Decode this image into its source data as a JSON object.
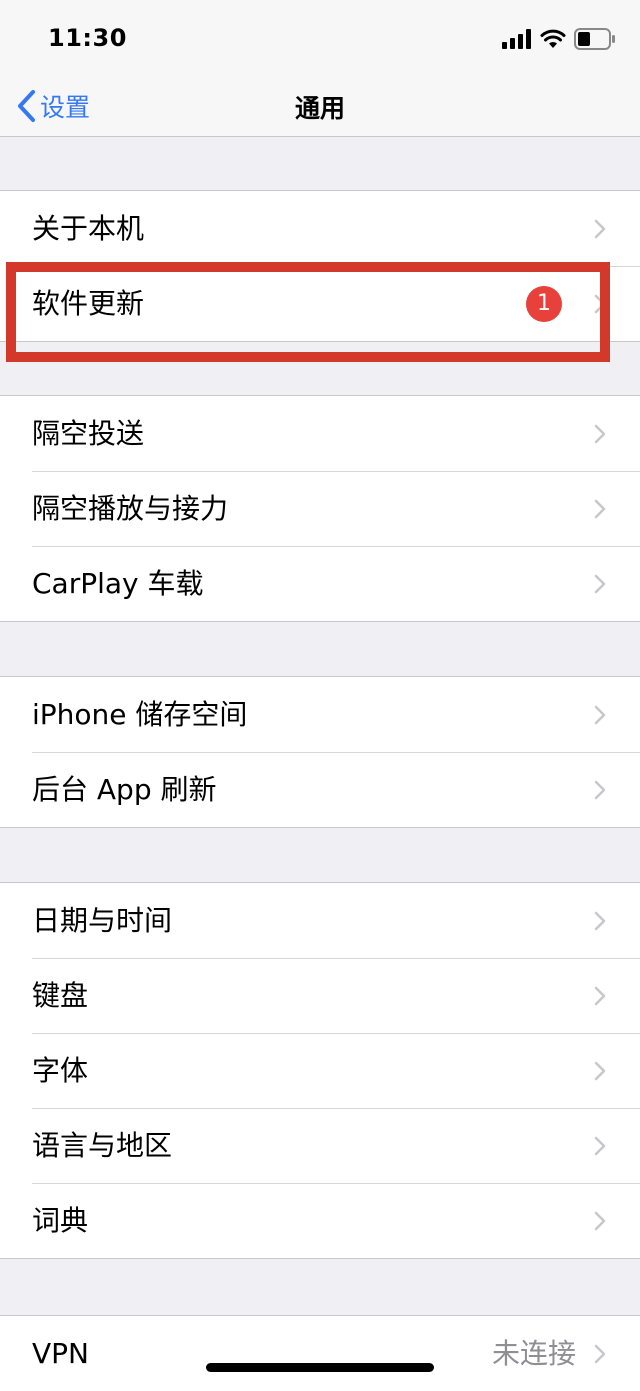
{
  "status_bar": {
    "time": "11:30",
    "icons": [
      "cellular-signal-icon",
      "wifi-icon",
      "battery-icon"
    ]
  },
  "nav": {
    "back_label": "设置",
    "title": "通用",
    "accent_color": "#3478f6"
  },
  "groups": [
    {
      "items": [
        {
          "id": "about",
          "label": "关于本机"
        },
        {
          "id": "software-update",
          "label": "软件更新",
          "badge": "1"
        }
      ]
    },
    {
      "items": [
        {
          "id": "airdrop",
          "label": "隔空投送"
        },
        {
          "id": "airplay-handoff",
          "label": "隔空播放与接力"
        },
        {
          "id": "carplay",
          "label": "CarPlay 车载"
        }
      ]
    },
    {
      "items": [
        {
          "id": "iphone-storage",
          "label": "iPhone 储存空间"
        },
        {
          "id": "background-app-refresh",
          "label": "后台 App 刷新"
        }
      ]
    },
    {
      "items": [
        {
          "id": "date-time",
          "label": "日期与时间"
        },
        {
          "id": "keyboard",
          "label": "键盘"
        },
        {
          "id": "fonts",
          "label": "字体"
        },
        {
          "id": "language-region",
          "label": "语言与地区"
        },
        {
          "id": "dictionary",
          "label": "词典"
        }
      ]
    },
    {
      "items": [
        {
          "id": "vpn",
          "label": "VPN",
          "detail": "未连接"
        }
      ]
    }
  ],
  "colors": {
    "badge": "#e8403a",
    "highlight": "#d3392b",
    "background": "#efeff4"
  }
}
